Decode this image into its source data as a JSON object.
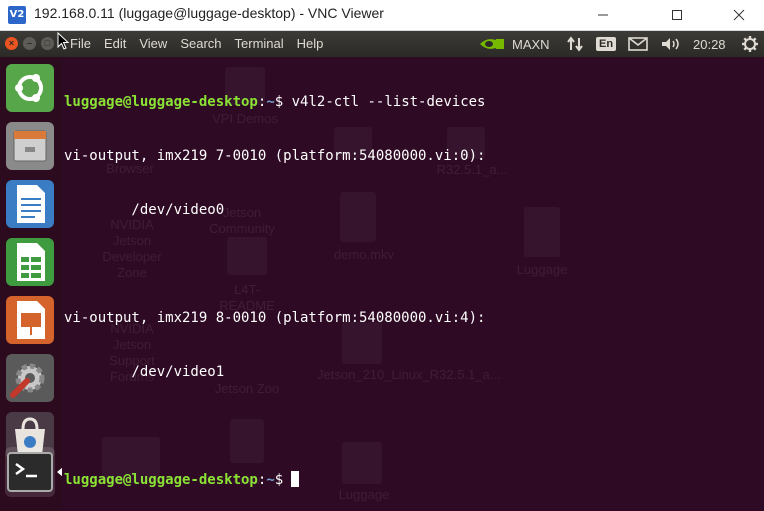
{
  "vnc": {
    "logo": "V2",
    "title": "192.168.0.11 (luggage@luggage-desktop) - VNC Viewer"
  },
  "panel": {
    "menu": [
      "File",
      "Edit",
      "View",
      "Search",
      "Terminal",
      "Help"
    ],
    "power_mode": "MAXN",
    "keyboard_layout": "En",
    "clock": "20:28",
    "icons": [
      "nvidia-icon",
      "network-icon",
      "keyboard-icon",
      "mail-icon",
      "volume-icon",
      "settings-gear-icon"
    ]
  },
  "launcher": {
    "items": [
      "ubuntu-dash-icon",
      "files-icon",
      "libreoffice-writer-icon",
      "libreoffice-calc-icon",
      "libreoffice-impress-icon",
      "system-settings-icon",
      "software-center-icon",
      "terminal-icon"
    ]
  },
  "terminal": {
    "prompt_user_host": "luggage@luggage-desktop",
    "prompt_sep": ":",
    "prompt_path": "~",
    "prompt_symbol": "$",
    "command": "v4l2-ctl --list-devices",
    "output": [
      "vi-output, imx219 7-0010 (platform:54080000.vi:0):",
      "        /dev/video0",
      "",
      "vi-output, imx219 8-0010 (platform:54080000.vi:4):",
      "        /dev/video1",
      ""
    ]
  },
  "desktop_icons": [
    "VPI Demos",
    "Browser",
    "Jetson Community",
    "NVIDIA Jetson Developer Zone",
    "demo.mkv",
    "L4T-README",
    "Luggage",
    "NVIDIA Jetson Support Forums",
    "Jetson Zoo",
    "Jetson_210_Linux_R32.5.1_a...",
    "l.raw",
    "Luggage",
    "R32.5.1_a..."
  ],
  "colors": {
    "terminal_bg": "#2f0a24",
    "prompt_green": "#8ae234",
    "path_blue": "#729fcf",
    "ubuntu_orange": "#e95420"
  }
}
